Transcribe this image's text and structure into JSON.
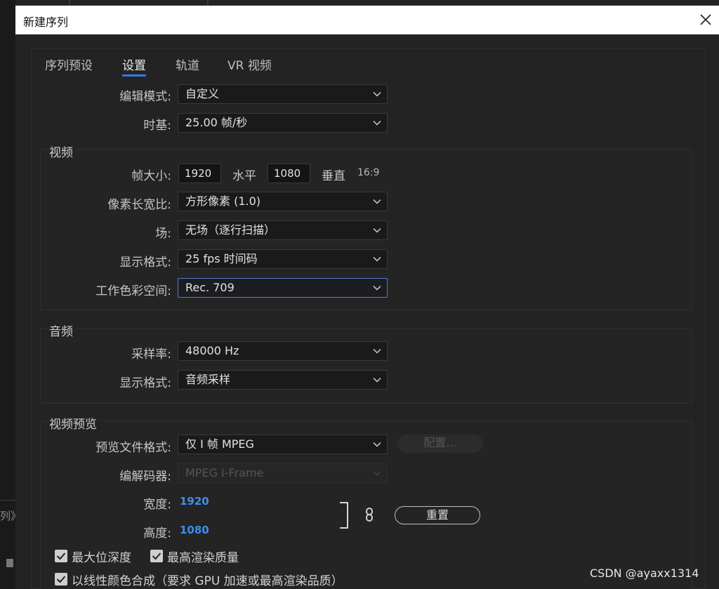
{
  "window": {
    "title": "新建序列"
  },
  "background": {
    "left_text": "列》"
  },
  "tabs": [
    {
      "label": "序列预设"
    },
    {
      "label": "设置",
      "active": true
    },
    {
      "label": "轨道"
    },
    {
      "label": "VR 视频"
    }
  ],
  "settings": {
    "edit_mode": {
      "label": "编辑模式:",
      "value": "自定义"
    },
    "timebase": {
      "label": "时基:",
      "value": "25.00  帧/秒"
    }
  },
  "video": {
    "title": "视频",
    "frame_size": {
      "label": "帧大小:",
      "width": "1920",
      "width_unit": "水平",
      "height": "1080",
      "height_unit": "垂直",
      "aspect": "16:9"
    },
    "pixel_aspect": {
      "label": "像素长宽比:",
      "value": "方形像素 (1.0)"
    },
    "field": {
      "label": "场:",
      "value": "无场（逐行扫描）"
    },
    "display_format": {
      "label": "显示格式:",
      "value": "25 fps 时间码"
    },
    "color_space": {
      "label": "工作色彩空间:",
      "value": "Rec. 709"
    }
  },
  "audio": {
    "title": "音频",
    "sample_rate": {
      "label": "采样率:",
      "value": "48000 Hz"
    },
    "display_format": {
      "label": "显示格式:",
      "value": "音频采样"
    }
  },
  "preview": {
    "title": "视频预览",
    "file_format": {
      "label": "预览文件格式:",
      "value": "仅 I 帧 MPEG"
    },
    "configure_label": "配置...",
    "codec": {
      "label": "编解码器:",
      "value": "MPEG I-Frame"
    },
    "width": {
      "label": "宽度:",
      "value": "1920"
    },
    "height": {
      "label": "高度:",
      "value": "1080"
    },
    "reset_label": "重置"
  },
  "options": {
    "max_bit_depth": {
      "label": "最大位深度",
      "checked": true
    },
    "max_render_quality": {
      "label": "最高渲染质量",
      "checked": true
    },
    "linear_color": {
      "label": "以线性颜色合成（要求 GPU 加速或最高渲染品质）",
      "checked": true
    }
  },
  "watermark": "CSDN @ayaxx1314",
  "colors": {
    "accent": "#2f7de1",
    "focus_border": "#4d7fd0",
    "value_blue": "#3e8df0"
  }
}
